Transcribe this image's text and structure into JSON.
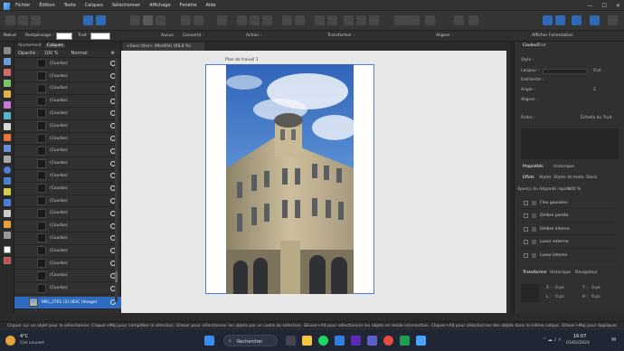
{
  "menu": {
    "items": [
      "Fichier",
      "Édition",
      "Texte",
      "Calques",
      "Sélectionner",
      "Affichage",
      "Fenêtre",
      "Aide"
    ]
  },
  "toolbar": {
    "mode_icons": [
      "photo-persona",
      "liquify-persona",
      "develop-persona",
      "tone-mapping-persona",
      "export-persona"
    ]
  },
  "context": {
    "mode_label": "Nœud",
    "style_label": "Remplissage :",
    "stroke_label": "Trait :",
    "none_label": "Aucun",
    "convert_label": "Convertir :",
    "action_label": "Action :",
    "transform_label": "Transformer :",
    "align_label": "Aligner :",
    "show_orientation": "Afficher l'orientation"
  },
  "layers_panel": {
    "tabs": [
      "Ajustement",
      "Calques"
    ],
    "opacity_label": "Opacité :",
    "opacity": "100 %",
    "blend": "Normal",
    "items": [
      {
        "name": "(Courbe)"
      },
      {
        "name": "(Courbe)"
      },
      {
        "name": "(Courbe)"
      },
      {
        "name": "(Courbe)"
      },
      {
        "name": "(Courbe)"
      },
      {
        "name": "(Courbe)"
      },
      {
        "name": "(Courbe)"
      },
      {
        "name": "(Courbe)"
      },
      {
        "name": "(Courbe)"
      },
      {
        "name": "(Courbe)"
      },
      {
        "name": "(Courbe)"
      },
      {
        "name": "(Courbe)"
      },
      {
        "name": "(Courbe)"
      },
      {
        "name": "(Courbe)"
      },
      {
        "name": "(Courbe)"
      },
      {
        "name": "(Courbe)"
      },
      {
        "name": "(Courbe)"
      },
      {
        "name": "(Courbe)"
      },
      {
        "name": "(Courbe)"
      }
    ],
    "active": {
      "name": "IMG_2761 (2).HEIC (Image)"
    }
  },
  "document": {
    "tab": "<Sans titre> (Modifié) (68,8 %)",
    "artboard_label": "Plan de travail 1"
  },
  "right_panel": {
    "tabs": [
      "Couleur",
      "Trait"
    ],
    "width_label": "Largeur :",
    "width_value": "0 pt",
    "style_label": "Style :",
    "cap_label": "Extrémité :",
    "join_label": "Angle :",
    "join_value": "2",
    "align_label": "Aligner :",
    "order_label": "Ordre :",
    "scale_label": "Échelle du Trait",
    "effects_tabs": [
      "Effets",
      "Styles",
      "Styles de texte",
      "Stock"
    ],
    "effects_sub_tabs": [
      "Propriétés",
      "Historique"
    ],
    "effects_header": "Aperçu du dégradé rapide :",
    "effects_header_value": "100 %",
    "effects": [
      {
        "name": "Flou gaussien"
      },
      {
        "name": "Ombre portée"
      },
      {
        "name": "Ombre interne"
      },
      {
        "name": "Lueur externe"
      },
      {
        "name": "Lueur interne"
      }
    ],
    "transform_tabs": [
      "Transformer",
      "Historique",
      "Navigateur"
    ],
    "transform_fields": [
      {
        "label": "X :",
        "value": "0 px"
      },
      {
        "label": "Y :",
        "value": "0 px"
      },
      {
        "label": "L :",
        "value": "0 px"
      },
      {
        "label": "H :",
        "value": "0 px"
      }
    ]
  },
  "status": {
    "text": "Cliquer sur un objet pour le sélectionner. Cliquer+Maj pour compléter la sélection. Glisser pour sélectionner les objets par un cadre de sélection. Glisser+Alt pour sélectionner les objets en mode intersection. Cliquer+Alt pour sélectionner des objets dans le même calque. Glisser+Maj pour dupliquer."
  },
  "taskbar": {
    "weather_temp": "4°C",
    "weather_desc": "Ciel couvert",
    "search_label": "Rechercher",
    "time": "16:07",
    "date": "01/02/2024"
  }
}
